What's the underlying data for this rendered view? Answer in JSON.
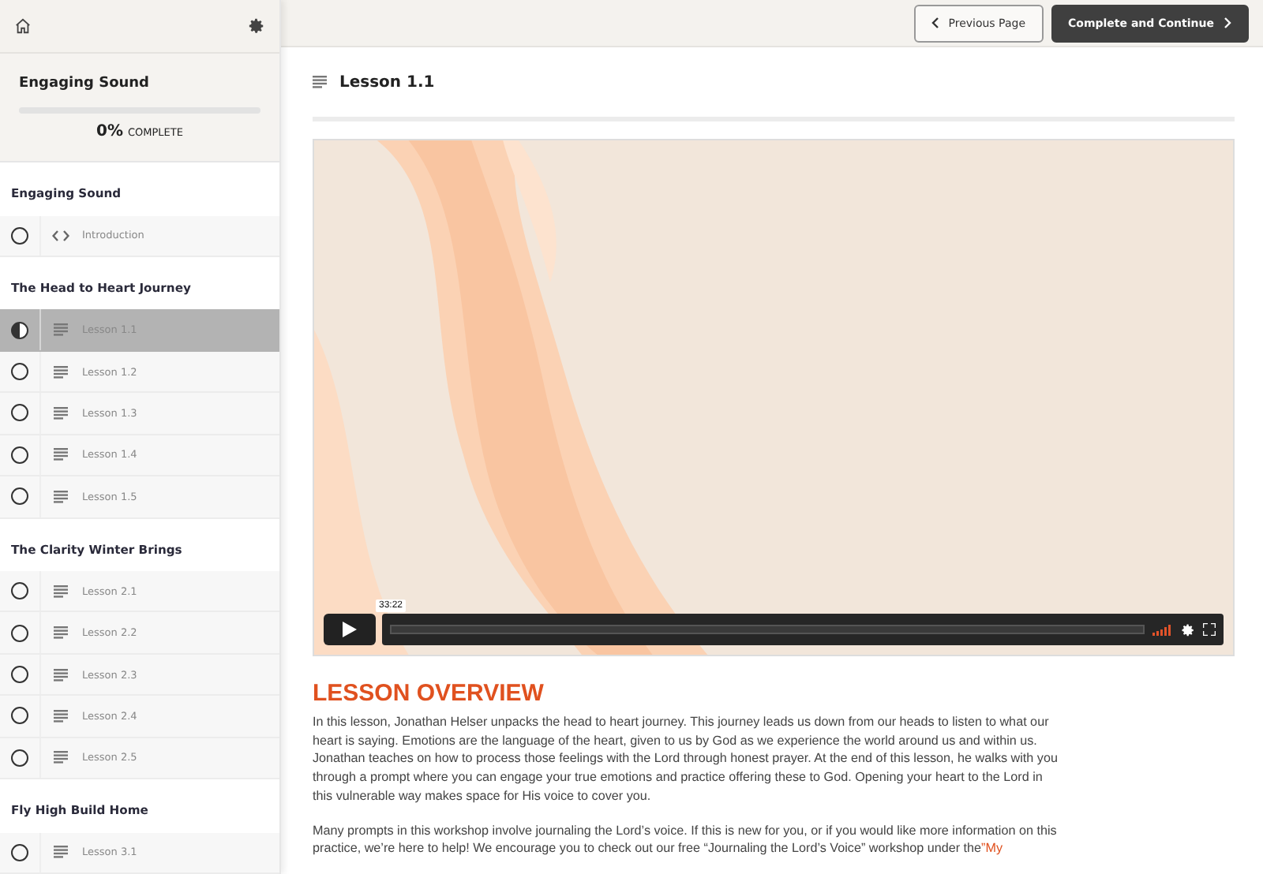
{
  "course": {
    "title": "Engaging Sound",
    "progress": {
      "level": 0,
      "percent": "0%",
      "label": "COMPLETE"
    }
  },
  "sections": [
    {
      "title": "Engaging Sound",
      "lessons": [
        {
          "title": "Introduction",
          "kind": "code",
          "in_progress": false,
          "selected": false
        }
      ]
    },
    {
      "title": "The Head to Heart Journey",
      "lessons": [
        {
          "title": "Lesson 1.1",
          "kind": "text",
          "in_progress": true,
          "selected": true
        },
        {
          "title": "Lesson 1.2",
          "kind": "text",
          "in_progress": false,
          "selected": false
        },
        {
          "title": "Lesson 1.3",
          "kind": "text",
          "in_progress": false,
          "selected": false
        },
        {
          "title": "Lesson 1.4",
          "kind": "text",
          "in_progress": false,
          "selected": false
        },
        {
          "title": "Lesson 1.5",
          "kind": "text",
          "in_progress": false,
          "selected": false
        }
      ]
    },
    {
      "title": "The Clarity Winter Brings",
      "lessons": [
        {
          "title": "Lesson 2.1",
          "kind": "text",
          "in_progress": false,
          "selected": false
        },
        {
          "title": "Lesson 2.2",
          "kind": "text",
          "in_progress": false,
          "selected": false
        },
        {
          "title": "Lesson 2.3",
          "kind": "text",
          "in_progress": false,
          "selected": false
        },
        {
          "title": "Lesson 2.4",
          "kind": "text",
          "in_progress": false,
          "selected": false
        },
        {
          "title": "Lesson 2.5",
          "kind": "text",
          "in_progress": false,
          "selected": false
        }
      ]
    },
    {
      "title": "Fly High Build Home",
      "lessons": [
        {
          "title": "Lesson 3.1",
          "kind": "text",
          "in_progress": false,
          "selected": false
        }
      ]
    }
  ],
  "header_buttons": [
    {
      "label": "Previous Page",
      "kind": "secondary"
    },
    {
      "label": "Complete and Continue",
      "kind": "primary"
    }
  ],
  "lesson": {
    "title": "Lesson 1.1"
  },
  "video": {
    "kind": "picture",
    "time": "33:22",
    "level": 0
  },
  "overview": {
    "heading": "LESSON OVERVIEW",
    "paragraphs": [
      {
        "text": "In this lesson, Jonathan Helser unpacks the head to heart journey. This journey leads us down from our heads to listen to what our heart is saying. Emotions are the language of the heart, given to us by God as we experience the world around us and within us. Jonathan teaches on how to process those feelings with the Lord through honest prayer. At the end of this lesson, he walks with you through a prompt where you can engage your true emotions and practice offering these to God. Opening your heart to the Lord in this vulnerable way makes space for His voice to cover you."
      },
      {
        "text": "Many prompts in this workshop involve journaling the Lord’s voice. If this is new for you, or if you would like more information on this practice, we’re here to help! We encourage you to check out our free “Journaling the Lord’s Voice” workshop under the",
        "link": "”My"
      }
    ]
  }
}
